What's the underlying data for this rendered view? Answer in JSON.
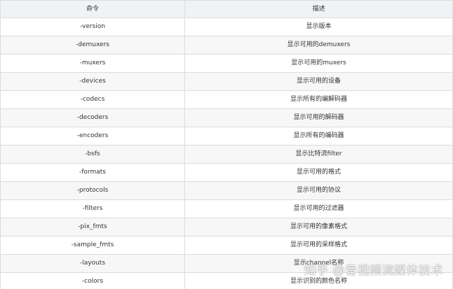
{
  "table": {
    "headers": [
      "命令",
      "描述"
    ],
    "rows": [
      {
        "command": "-version",
        "description": "显示版本"
      },
      {
        "command": "-demuxers",
        "description": "显示可用的demuxers"
      },
      {
        "command": "-muxers",
        "description": "显示可用的muxers"
      },
      {
        "command": "-devices",
        "description": "显示可用的设备"
      },
      {
        "command": "-codecs",
        "description": "显示所有的编解码器"
      },
      {
        "command": "-decoders",
        "description": "显示可用的解码器"
      },
      {
        "command": "-encoders",
        "description": "显示所有的编码器"
      },
      {
        "command": "-bsfs",
        "description": "显示比特流filter"
      },
      {
        "command": "-formats",
        "description": "显示可用的格式"
      },
      {
        "command": "-protocols",
        "description": "显示可用的协议"
      },
      {
        "command": "-filters",
        "description": "显示可用的过滤器"
      },
      {
        "command": "-pix_fmts",
        "description": "显示可用的像素格式"
      },
      {
        "command": "-sample_fmts",
        "description": "显示可用的采样格式"
      },
      {
        "command": "-layouts",
        "description": "显示channel名称"
      },
      {
        "command": "-colors",
        "description": "显示识别的颜色名称"
      }
    ]
  },
  "watermark": "知乎 @音视频流媒体技术"
}
